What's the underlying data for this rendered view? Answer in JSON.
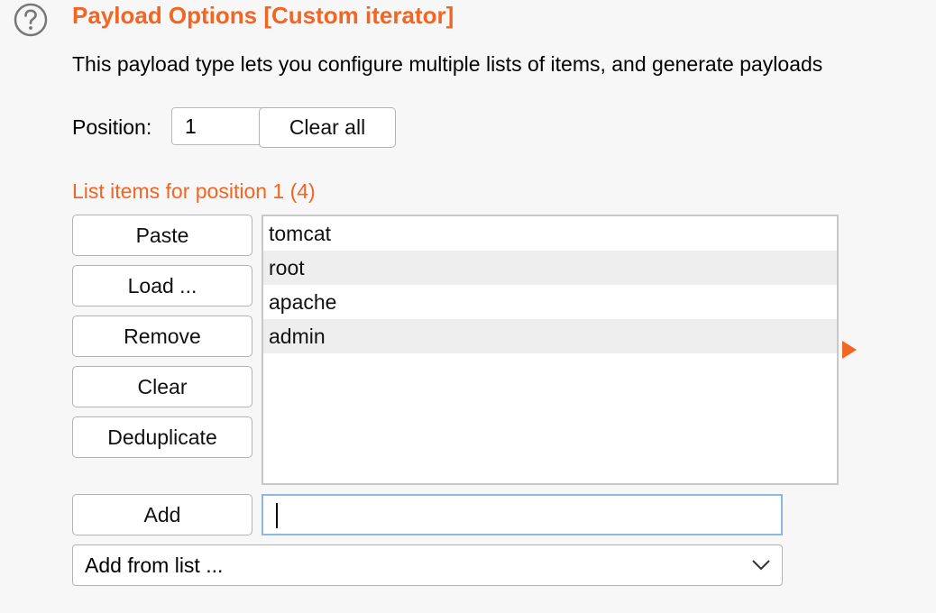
{
  "section": {
    "title": "Payload Options [Custom iterator]",
    "description": "This payload type lets you configure multiple lists of items, and generate payloads",
    "help_icon": "question-circle-icon"
  },
  "position": {
    "label": "Position:",
    "value": "1",
    "clear_all_label": "Clear all"
  },
  "list": {
    "heading": "List items for position 1 (4)",
    "items": [
      "tomcat",
      "root",
      "apache",
      "admin"
    ]
  },
  "buttons": {
    "paste": "Paste",
    "load": "Load ...",
    "remove": "Remove",
    "clear": "Clear",
    "deduplicate": "Deduplicate",
    "add": "Add"
  },
  "add_input": {
    "value": ""
  },
  "add_from_list": {
    "selected": "Add from list ...",
    "icon": "chevron-down-icon"
  },
  "colors": {
    "accent": "#f26522",
    "focus_border": "#8db8e0",
    "alt_row": "#eeeeee"
  }
}
